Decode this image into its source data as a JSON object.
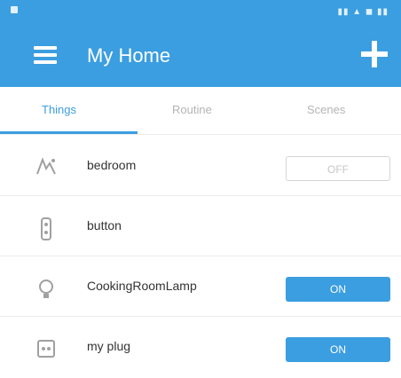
{
  "app_bar": {
    "title": "My Home"
  },
  "tabs": [
    {
      "label": "Things",
      "active": true
    },
    {
      "label": "Routine",
      "active": false
    },
    {
      "label": "Scenes",
      "active": false
    }
  ],
  "devices": [
    {
      "name": "bedroom",
      "icon": "thermostat-icon",
      "toggle": {
        "state": "off",
        "label": "OFF"
      }
    },
    {
      "name": "button",
      "icon": "remote-button-icon",
      "toggle": null
    },
    {
      "name": "CookingRoomLamp",
      "icon": "lamp-icon",
      "toggle": {
        "state": "on",
        "label": "ON"
      }
    },
    {
      "name": "my plug",
      "icon": "plug-icon",
      "toggle": {
        "state": "on",
        "label": "ON"
      }
    }
  ],
  "colors": {
    "accent": "#3b9ee0",
    "text": "#333333",
    "muted": "#b4b4b4"
  }
}
